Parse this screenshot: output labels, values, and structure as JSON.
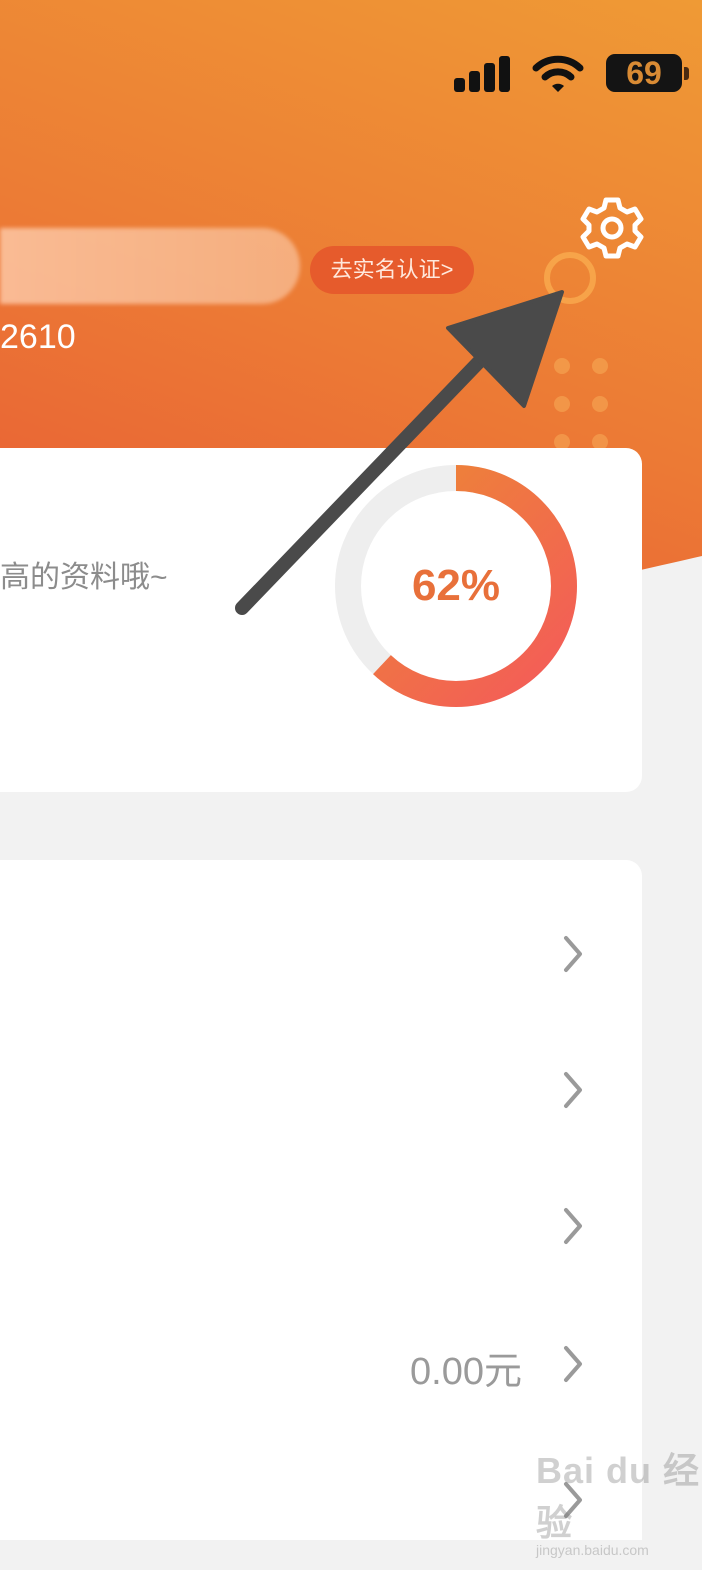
{
  "status_bar": {
    "battery": "69"
  },
  "header": {
    "verify_label": "去实名认证>",
    "user_id": "2610"
  },
  "profile_card": {
    "hint": "高的资料哦~",
    "progress_text": "62%",
    "progress_value": 0.62
  },
  "menu": {
    "rows": [
      {
        "value": ""
      },
      {
        "value": ""
      },
      {
        "value": ""
      },
      {
        "value": "0.00元"
      },
      {
        "value": ""
      }
    ]
  },
  "watermark": {
    "logo": "Bai du 经验",
    "sub": "jingyan.baidu.com"
  },
  "colors": {
    "header_start": "#e85c35",
    "header_end": "#ef9a35",
    "accent": "#e8703a",
    "arrow": "#4a4a4a"
  },
  "icons": [
    "signal-icon",
    "wifi-icon",
    "battery-icon",
    "settings-gear-icon",
    "chevron-right-icon",
    "annotation-arrow-icon"
  ]
}
